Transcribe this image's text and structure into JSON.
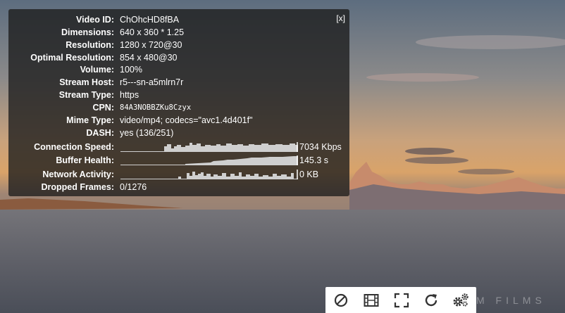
{
  "stats": {
    "close_label": "[x]",
    "rows": [
      {
        "label": "Video ID:",
        "value": "ChOhcHD8fBA"
      },
      {
        "label": "Dimensions:",
        "value": "640 x 360 * 1.25"
      },
      {
        "label": "Resolution:",
        "value": "1280 x 720@30"
      },
      {
        "label": "Optimal Resolution:",
        "value": "854 x 480@30"
      },
      {
        "label": "Volume:",
        "value": "100%"
      },
      {
        "label": "Stream Host:",
        "value": "r5---sn-a5mlrn7r"
      },
      {
        "label": "Stream Type:",
        "value": "https"
      },
      {
        "label": "CPN:",
        "value": "84A3NOBBZKu8Czyx"
      },
      {
        "label": "Mime Type:",
        "value": "video/mp4; codecs=\"avc1.4d401f\""
      },
      {
        "label": "DASH:",
        "value": "yes (136/251)"
      }
    ],
    "connection_speed": {
      "label": "Connection Speed:",
      "value": "7034 Kbps"
    },
    "buffer_health": {
      "label": "Buffer Health:",
      "value": "145.3 s"
    },
    "network_activity": {
      "label": "Network Activity:",
      "value": "0 KB"
    },
    "dropped_frames": {
      "label": "Dropped Frames:",
      "value": "0/1276"
    }
  },
  "controls": {
    "buttons": [
      "block-icon",
      "film-icon",
      "fullscreen-icon",
      "refresh-icon",
      "settings-icon"
    ]
  },
  "watermark": {
    "text": "M FILMS"
  },
  "colors": {
    "panel_bg": "#1c1c1c",
    "text": "#ffffff",
    "graph": "#cfcfcf"
  }
}
